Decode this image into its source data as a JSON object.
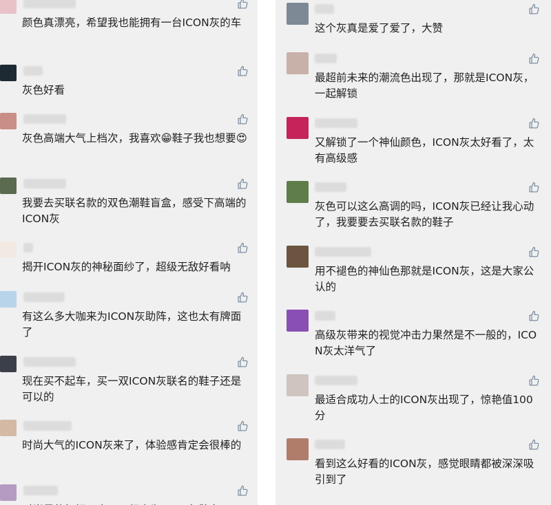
{
  "left_comments": [
    {
      "text": "颜色真漂亮，希望我也能拥有一台ICON灰的车",
      "avatar_color": "#e9c2c8"
    },
    {
      "text": "灰色好看",
      "avatar_color": "#1d2a33"
    },
    {
      "text": "灰色高端大气上档次，我喜欢😁鞋子我也想要😍",
      "avatar_color": "#c98e86"
    },
    {
      "text": "我要去买联名款的双色潮鞋盲盒，感受下高端的ICON灰",
      "avatar_color": "#5a6b4f"
    },
    {
      "text": "揭开ICON灰的神秘面纱了，超级无敌好看呐",
      "avatar_color": "#f2e9e2"
    },
    {
      "text": "有这么多大咖来为ICON灰助阵，这也太有牌面了",
      "avatar_color": "#b8d4ea"
    },
    {
      "text": "现在买不起车，买一双ICON灰联名的鞋子还是可以的",
      "avatar_color": "#3b3f4a"
    },
    {
      "text": "时尚大气的ICON灰来了，体验感肯定会很棒的",
      "avatar_color": "#d4b9a4"
    },
    {
      "text": "时尚界的扛把子来了，都来为ICON灰助力",
      "avatar_color": "#b59bc2"
    }
  ],
  "right_comments": [
    {
      "text": "这个灰真是爱了爱了，大赞",
      "avatar_color": "#7d8a96"
    },
    {
      "text": "最超前未来的潮流色出现了，那就是ICON灰，一起解锁",
      "avatar_color": "#c7b1a8"
    },
    {
      "text": "又解锁了一个神仙颜色，ICON灰太好看了，太有高级感",
      "avatar_color": "#c4245a"
    },
    {
      "text": "灰色可以这么高调的吗，ICON灰已经让我心动了，我要要去买联名款的鞋子",
      "avatar_color": "#5e7d4a"
    },
    {
      "text": "用不褪色的神仙色那就是ICON灰，这是大家公认的",
      "avatar_color": "#6b5540"
    },
    {
      "text": "高级灰带来的视觉冲击力果然是不一般的，ICON灰太洋气了",
      "avatar_color": "#8a4fb3"
    },
    {
      "text": "最适合成功人士的ICON灰出现了，惊艳值100分",
      "avatar_color": "#cfc4bf"
    },
    {
      "text": "看到这么好看的ICON灰，感觉眼睛都被深深吸引到了",
      "avatar_color": "#b07d6b"
    }
  ],
  "like_icon": "thumbs-up-outline",
  "like_color": "#7d8ea3"
}
